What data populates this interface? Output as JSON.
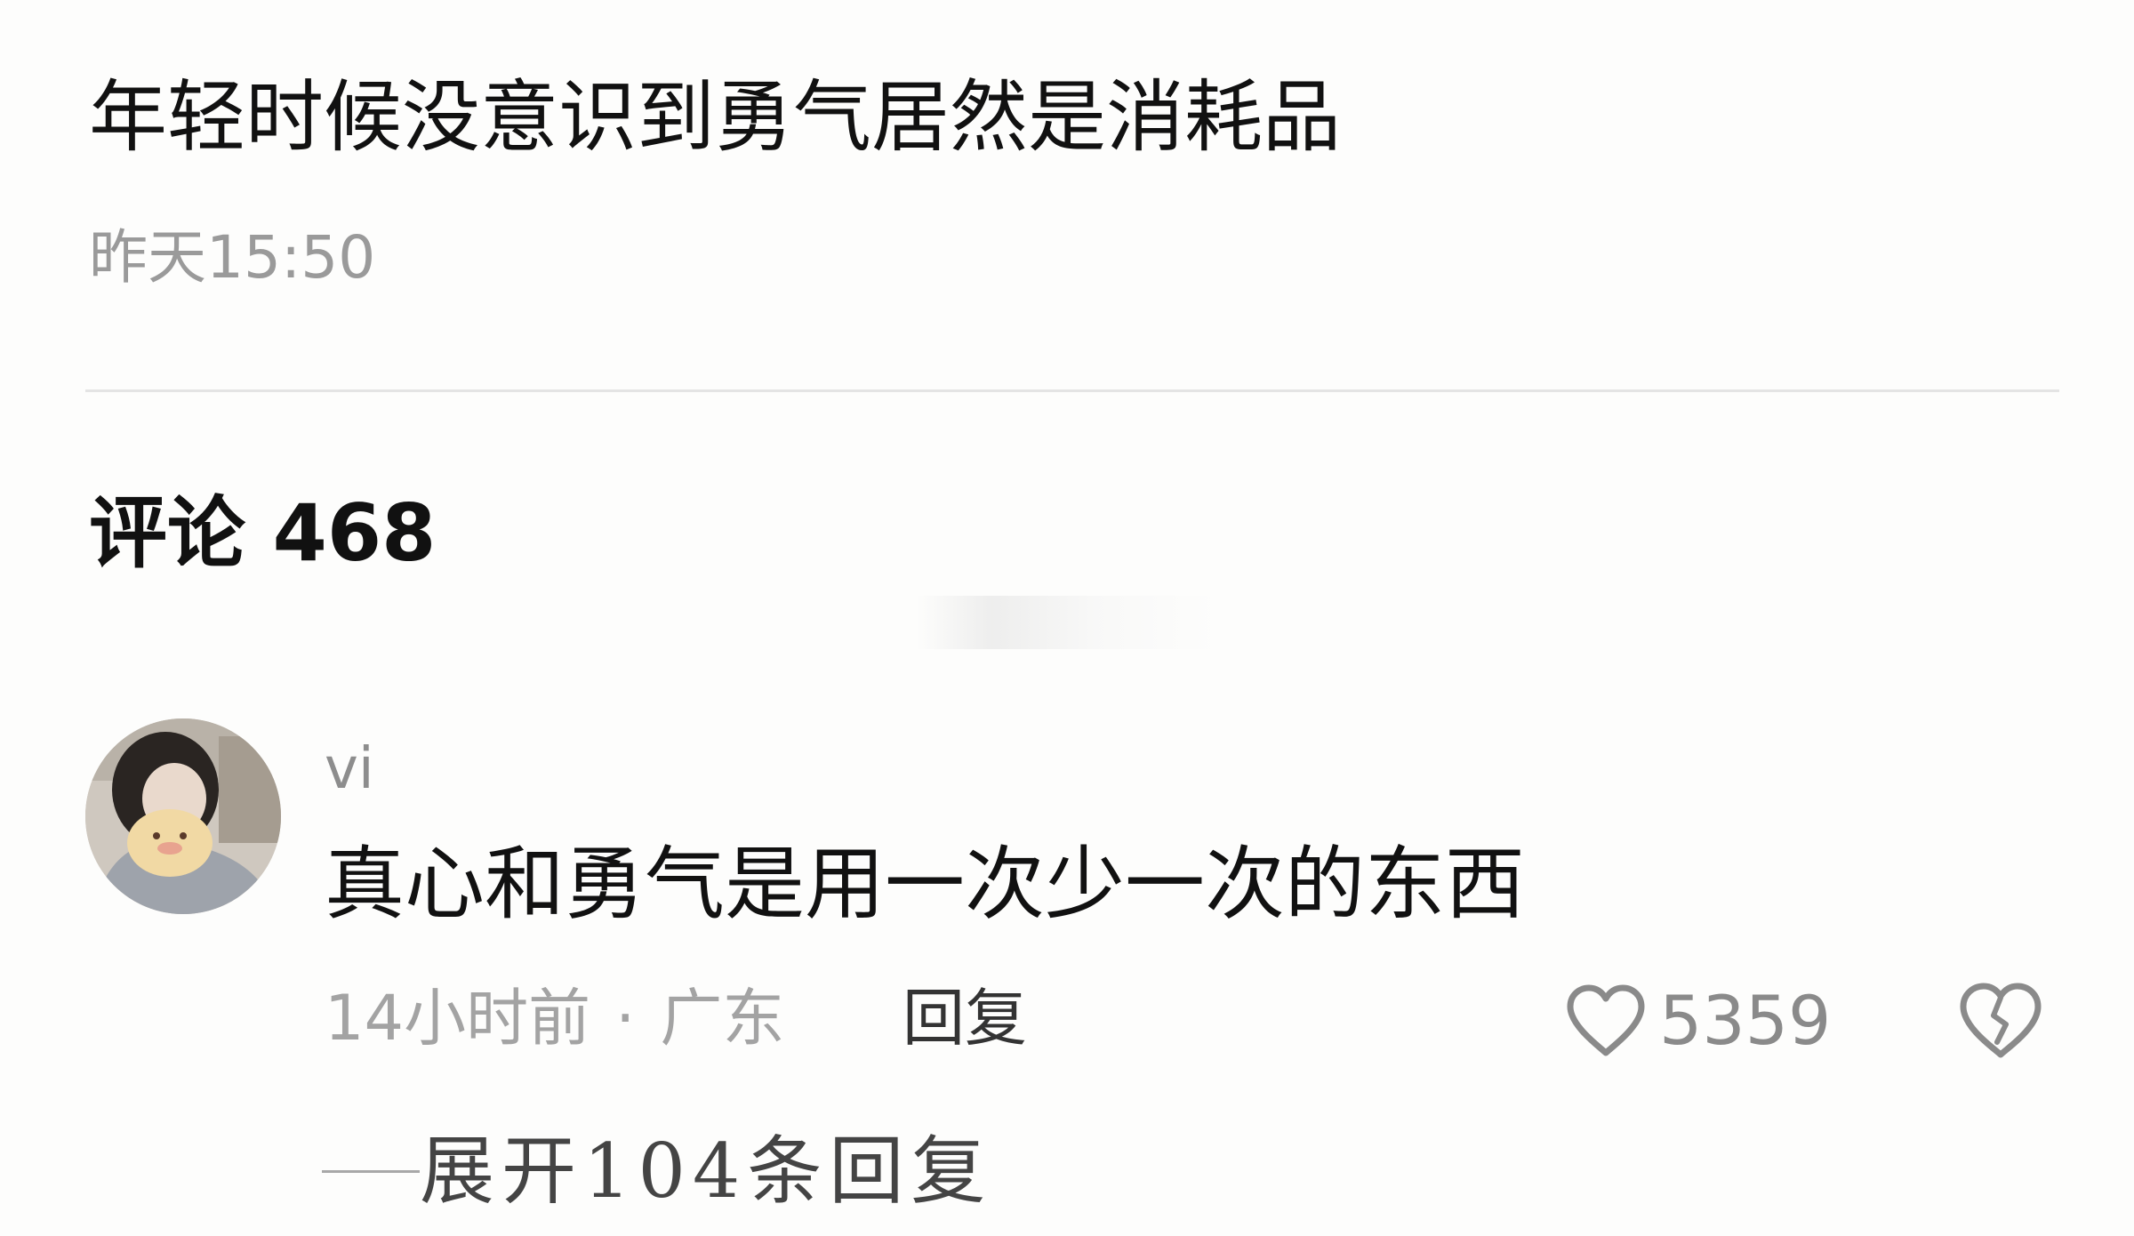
{
  "post": {
    "title": "年轻时候没意识到勇气居然是消耗品",
    "time": "昨天15:50"
  },
  "comments_section": {
    "header": "评论 468"
  },
  "comment": {
    "username": "vi",
    "text": "真心和勇气是用一次少一次的东西",
    "time": "14小时前",
    "separator": "·",
    "location": "广东",
    "reply_label": "回复",
    "like_count": "5359",
    "expand_replies_label": "展开104条回复"
  },
  "icons": {
    "like": "heart-outline-icon",
    "dislike": "broken-heart-icon"
  },
  "colors": {
    "background": "#fdfdfc",
    "primary_text": "#111111",
    "secondary_text": "#9a9a9a",
    "divider": "#e4e4e4"
  }
}
